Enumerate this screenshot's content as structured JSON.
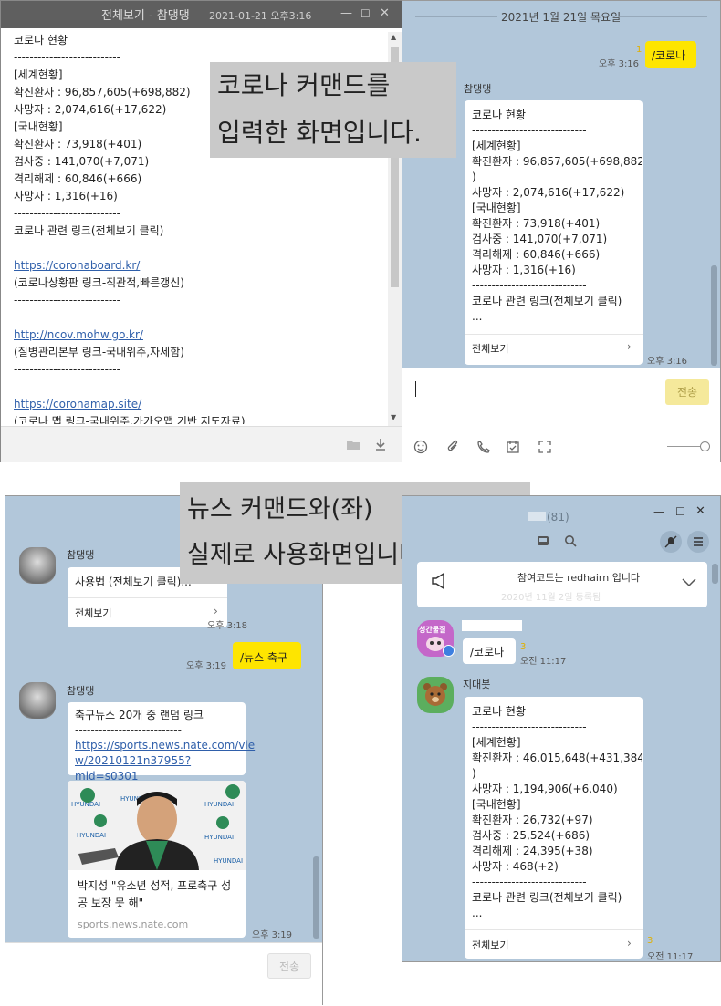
{
  "win1": {
    "title": "전체보기 - 참댕댕",
    "datetime": "2021-01-21 오후3:16",
    "lines": [
      "코로나 현황",
      "---------------------------",
      "[세계현황]",
      "확진환자 : 96,857,605(+698,882)",
      "사망자 : 2,074,616(+17,622)",
      "[국내현황]",
      "확진환자 : 73,918(+401)",
      "검사중 : 141,070(+7,071)",
      "격리해제 : 60,846(+666)",
      "사망자 : 1,316(+16)",
      "---------------------------",
      "코로나 관련 링크(전체보기 클릭)",
      "",
      "https://coronaboard.kr/",
      "(코로나상황판 링크-직관적,빠른갱신)",
      "---------------------------",
      "",
      "http://ncov.mohw.go.kr/",
      "(질병관리본부 링크-국내위주,자세함)",
      "---------------------------",
      "",
      "https://coronamap.site/",
      "(코로나 맵 링크-국내위주,카카오맵 기반 지도자료)"
    ]
  },
  "win2": {
    "date_divider": "2021년 1월 21일 목요일",
    "my_msg": {
      "text": "/코로나",
      "time": "오후 3:16",
      "unread": "1"
    },
    "sender": "참댕댕",
    "bubble_lines": [
      "코로나 현황",
      "-----------------------------",
      "[세계현황]",
      "확진환자 : 96,857,605(+698,882",
      ")",
      "사망자 : 2,074,616(+17,622)",
      "[국내현황]",
      "확진환자 : 73,918(+401)",
      "검사중 : 141,070(+7,071)",
      "격리해제 : 60,846(+666)",
      "사망자 : 1,316(+16)",
      "-----------------------------",
      "코로나 관련 링크(전체보기 클릭)",
      "..."
    ],
    "view_all": "전체보기",
    "reply_time": "오후 3:16",
    "send_label": "전송"
  },
  "overlay1": {
    "line1": "코로나 커맨드를",
    "line2": "입력한 화면입니다."
  },
  "overlay2": {
    "line1": "뉴스 커맨드와(좌)",
    "line2": "실제로 사용화면입니다(우)"
  },
  "win3": {
    "sender1": "참댕댕",
    "usage_text": "사용법 (전체보기 클릭)...",
    "view_all": "전체보기",
    "time1": "오후 3:18",
    "my_msg": {
      "text": "/뉴스 축구",
      "time": "오후 3:19"
    },
    "sender2": "참댕댕",
    "news_title": "축구뉴스 20개 중 랜덤 링크",
    "news_sep": "---------------------------",
    "news_link1": "https://sports.news.nate.com/vie",
    "news_link2": "w/20210121n37955?mid=s0301",
    "card_title": "박지성 \"유소년 성적, 프로축구 성공 보장 못 해\"",
    "card_domain": "sports.news.nate.com",
    "time2": "오후 3:19",
    "send_label": "전송"
  },
  "win4": {
    "member_count": "(81)",
    "notice_text": "참여코드는 redhairn 입니다",
    "notice_sub": "2020년 11월 2일 등록됨",
    "avatar1_label": "성간물질",
    "my_msg": {
      "text": "/코로나",
      "time": "오전 11:17",
      "unread": "3"
    },
    "sender": "지대봇",
    "bubble_lines": [
      "코로나 현황",
      "-----------------------------",
      "[세계현황]",
      "확진환자 : 46,015,648(+431,384",
      ")",
      "사망자 : 1,194,906(+6,040)",
      "[국내현황]",
      "확진환자 : 26,732(+97)",
      "검사중 : 25,524(+686)",
      "격리해제 : 24,395(+38)",
      "사망자 : 468(+2)",
      "-----------------------------",
      "코로나 관련 링크(전체보기 클릭)",
      "..."
    ],
    "view_all": "전체보기",
    "reply_time": "오전 11:17",
    "reply_unread": "3"
  }
}
